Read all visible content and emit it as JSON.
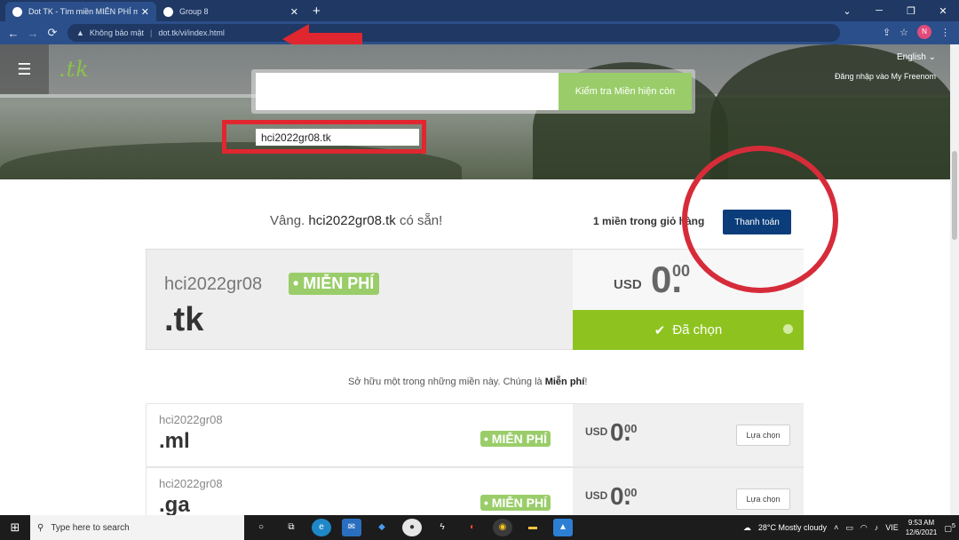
{
  "browser": {
    "tabs": [
      {
        "title": "Dot TK - Tìm miền MIỄN PHÍ mới",
        "active": true
      },
      {
        "title": "Group 8",
        "active": false
      }
    ],
    "new_tab": "+",
    "window_controls": [
      "⌄",
      "─",
      "❐",
      "✕"
    ],
    "address": {
      "security_label": "Không bảo mật",
      "url": "dot.tk/vi/index.html"
    },
    "profile_initial": "N"
  },
  "site": {
    "logo": ".tk",
    "language": "English",
    "login": "Đăng nhập vào My Freenom",
    "search": {
      "value": "hci2022gr08.tk",
      "button_label": "Kiểm tra Miền hiện còn"
    }
  },
  "result": {
    "prefix": "Vâng.",
    "domain": "hci2022gr08.tk",
    "suffix": "có sẵn!",
    "cart_text": "1 miền trong giỏ hàng",
    "checkout_label": "Thanh toán"
  },
  "selected": {
    "sld": "hci2022gr08",
    "tld": ".tk",
    "badge": "• MIỄN PHÍ",
    "currency": "USD",
    "price_int": "0.",
    "price_cents": "00",
    "status": "Đã chọn"
  },
  "ownership_line": {
    "text": "Sở hữu một trong những miền này. Chúng là",
    "bold": "Miễn phí",
    "end": "!"
  },
  "alternatives": [
    {
      "sld": "hci2022gr08",
      "tld": ".ml",
      "badge": "• MIỄN PHÍ",
      "currency": "USD",
      "price_int": "0.",
      "price_cents": "00",
      "button": "Lựa chọn"
    },
    {
      "sld": "hci2022gr08",
      "tld": ".ga",
      "badge": "• MIỄN PHÍ",
      "currency": "USD",
      "price_int": "0.",
      "price_cents": "00",
      "button": "Lựa chọn"
    }
  ],
  "taskbar": {
    "search_placeholder": "Type here to search",
    "weather": "28°C  Mostly cloudy",
    "lang": "VIE",
    "time": "9:53 AM",
    "date": "12/6/2021",
    "notifications": "5"
  },
  "colors": {
    "accent_green": "#8ec31f",
    "button_blue": "#0b3d7a",
    "annotation_red": "#e0272f"
  }
}
